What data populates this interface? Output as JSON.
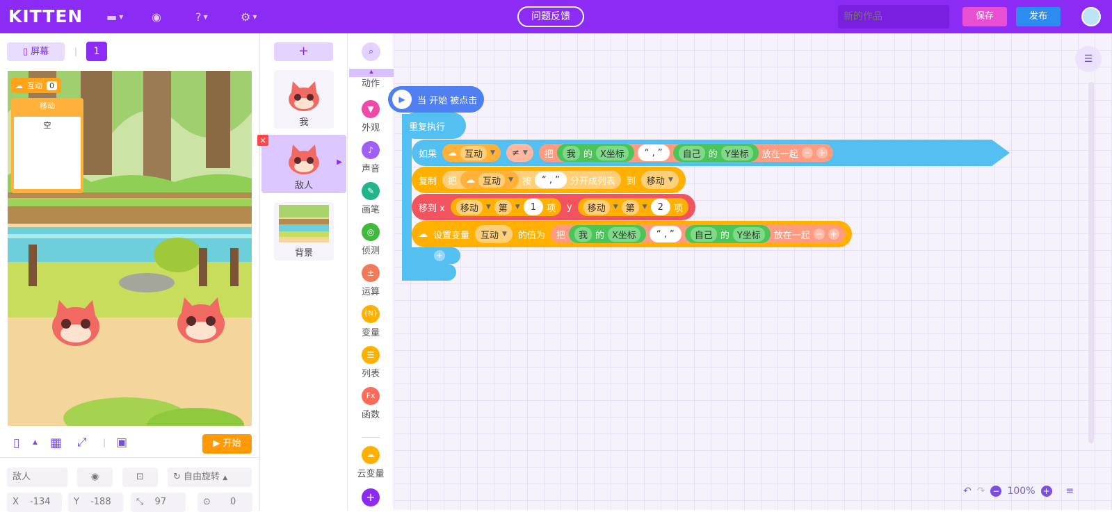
{
  "topbar": {
    "logo": "KITTEN",
    "feedback": "问题反馈",
    "title_placeholder": "新的作品",
    "save": "保存",
    "publish": "发布"
  },
  "stage": {
    "screen_btn": "屏幕",
    "page_num": "1",
    "monitor_label": "互动",
    "monitor_value": "0",
    "list_title": "移动",
    "list_empty": "空",
    "start": "开始"
  },
  "sprite_props": {
    "name": "敌人",
    "rotate": "自由旋转",
    "x_label": "X",
    "x_value": "-134",
    "y_label": "Y",
    "y_value": "-188",
    "size_value": "97",
    "dir_value": "0"
  },
  "sprites": [
    {
      "name": "我"
    },
    {
      "name": "敌人"
    },
    {
      "name": "背景"
    }
  ],
  "categories": [
    {
      "label": "动作",
      "color": "#7c5cff"
    },
    {
      "label": "外观",
      "color": "#f04aa8"
    },
    {
      "label": "声音",
      "color": "#a05ff5"
    },
    {
      "label": "画笔",
      "color": "#21b58c"
    },
    {
      "label": "侦测",
      "color": "#3fba3a"
    },
    {
      "label": "运算",
      "color": "#f07a5a"
    },
    {
      "label": "变量",
      "color": "#ffb000"
    },
    {
      "label": "列表",
      "color": "#ffb000"
    },
    {
      "label": "函数",
      "color": "#ff6a5a"
    },
    {
      "label": "云变量",
      "color": "#ffb000"
    }
  ],
  "code": {
    "hat": "当 开始 被点击",
    "repeat": "重复执行",
    "if_label": "如果",
    "var_interact": "互动",
    "neq": "≠",
    "join_prefix": "把",
    "me": "我",
    "of": "的",
    "x_coord": "X坐标",
    "comma": "“ , ”",
    "self": "自己",
    "y_coord": "Y坐标",
    "join_suffix": "放在一起",
    "copy": "复制",
    "split_by": "按",
    "split_to": "分开成列表",
    "to": "到",
    "list_move": "移动",
    "move_to_x": "移到 x",
    "item_prefix": "第",
    "item_suffix": "项",
    "item1": "1",
    "y": "y",
    "item2": "2",
    "set_var": "设置变量",
    "set_to": "的值为"
  },
  "zoom": "100%"
}
